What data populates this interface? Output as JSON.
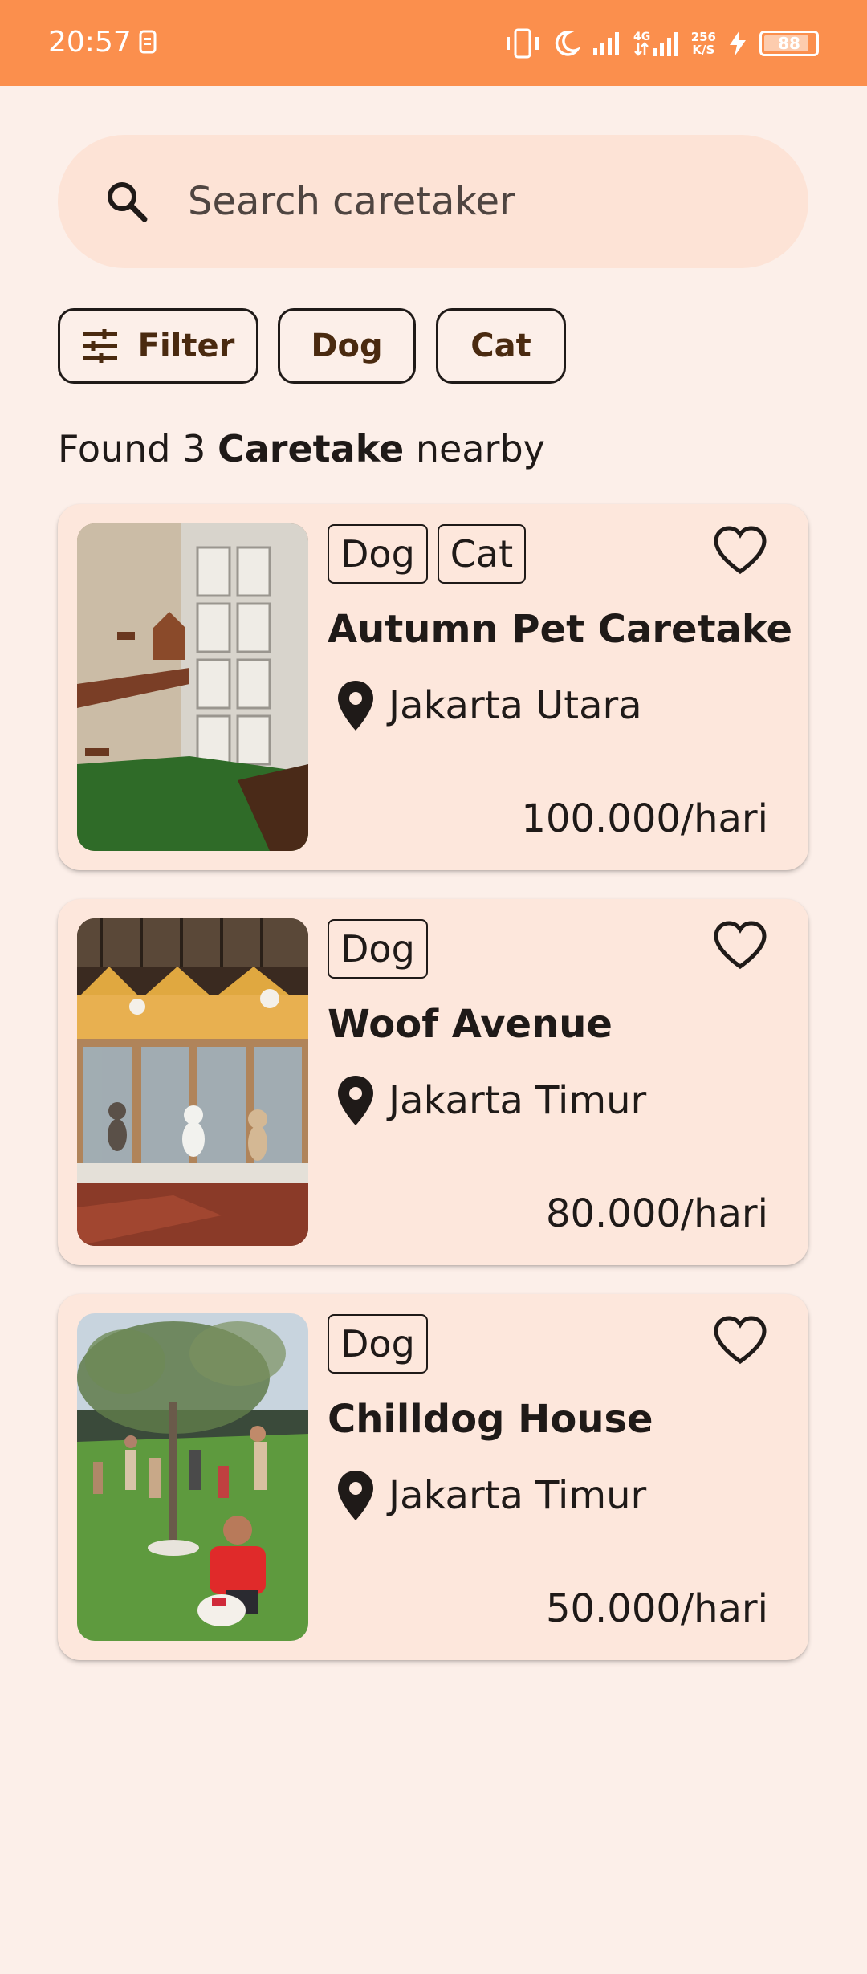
{
  "status_bar": {
    "time": "20:57",
    "net_speed_value": "256",
    "net_speed_unit": "K/S",
    "network_label": "4G",
    "battery": "88",
    "battery_level": 0.88
  },
  "search": {
    "placeholder": "Search caretaker"
  },
  "filters": {
    "filter_label": "Filter",
    "dog_label": "Dog",
    "cat_label": "Cat"
  },
  "results": {
    "prefix": "Found 3 ",
    "bold": "Caretake",
    "suffix": " nearby"
  },
  "cards": [
    {
      "tags": [
        "Dog",
        "Cat"
      ],
      "name": "Autumn Pet Caretake",
      "location": "Jakarta Utara",
      "price": "100.000/hari",
      "favorited": false
    },
    {
      "tags": [
        "Dog"
      ],
      "name": "Woof Avenue",
      "location": "Jakarta Timur",
      "price": "80.000/hari",
      "favorited": false
    },
    {
      "tags": [
        "Dog"
      ],
      "name": "Chilldog House",
      "location": "Jakarta Timur",
      "price": "50.000/hari",
      "favorited": false
    }
  ],
  "colors": {
    "status_bar": "#fb8f4d",
    "background": "#fcefe9",
    "search_bg": "#fde3d6",
    "card_bg": "#fde7dc",
    "chip_text": "#4a2a10"
  },
  "icons": [
    "search-icon",
    "filter-icon",
    "heart-outline-icon",
    "location-pin-icon"
  ]
}
